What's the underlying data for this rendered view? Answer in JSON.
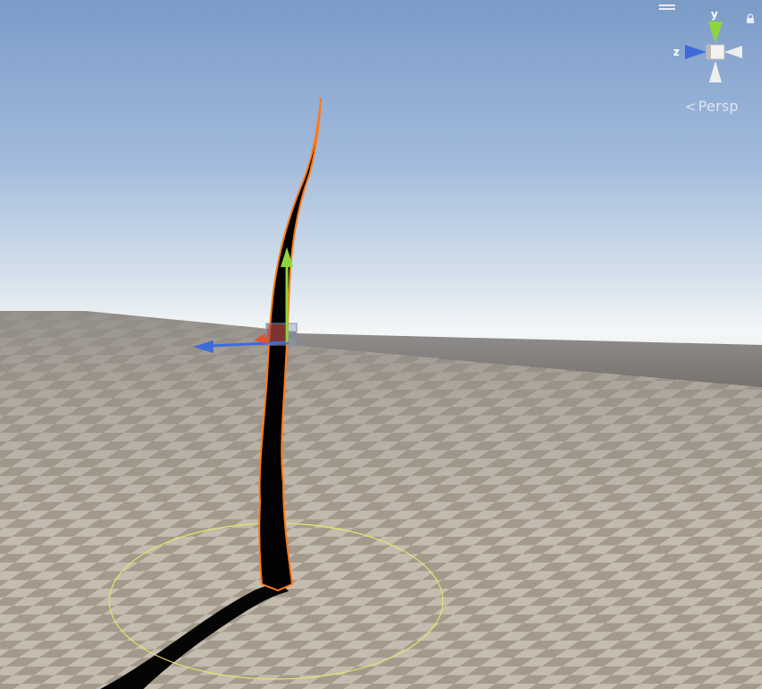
{
  "scene_view": {
    "projection_label": "Persp",
    "axis_labels": {
      "y": "y",
      "z": "z"
    },
    "icons": {
      "menu": "hamburger-menu-icon",
      "lock": "lock-icon",
      "orientation_gizmo": "scene-orientation-gizmo-icon",
      "move_tool": "move-tool-gizmo-icon"
    },
    "colors": {
      "sky_top": "#7b9bc8",
      "horizon": "#f2f6f8",
      "ground_light": "#c5bdb0",
      "ground_dark": "#978c7e",
      "selection_outline": "#ff7a1a",
      "y_axis": "#8fd63a",
      "z_axis": "#3d6bdb",
      "x_axis": "#e0542f",
      "light_range_circle": "#e8e26c"
    }
  }
}
